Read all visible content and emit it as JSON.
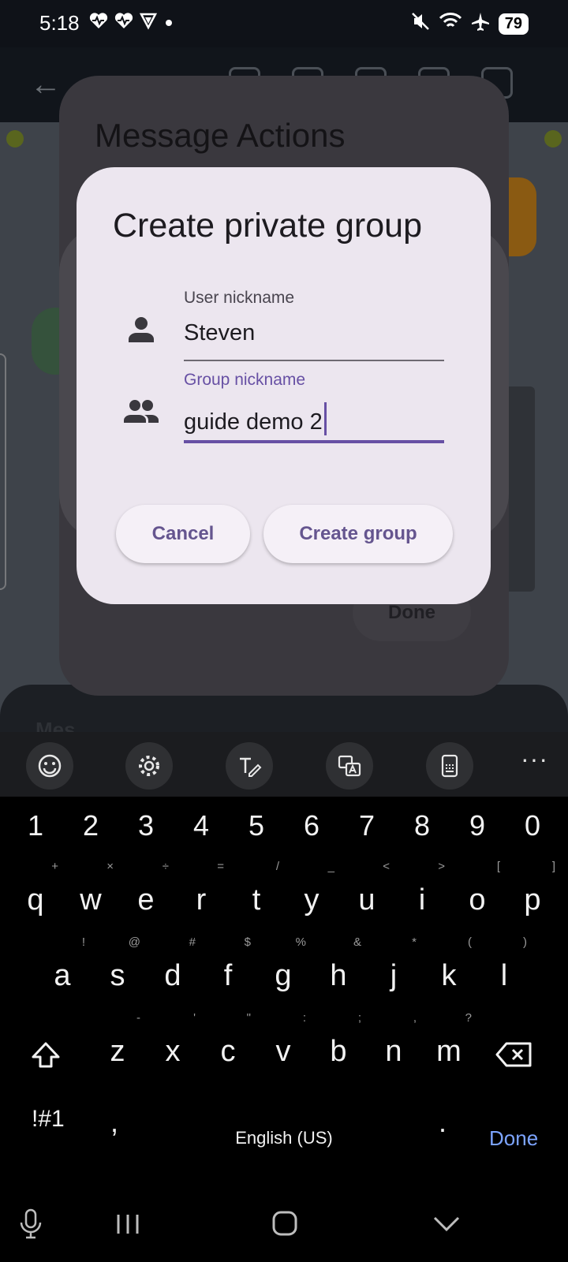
{
  "status_bar": {
    "time": "5:18",
    "battery": "79",
    "left_icons": [
      "heartbeat-icon",
      "heartbeat-icon",
      "vpn-shield-icon",
      "notification-dot-icon"
    ],
    "right_icons": [
      "mute-icon",
      "wifi-icon",
      "airplane-icon"
    ]
  },
  "background_dialog": {
    "title": "Message Actions",
    "done_label": "Done",
    "sheet_text": "Mes"
  },
  "dialog": {
    "title": "Create private group",
    "user_field": {
      "label": "User nickname",
      "value": "Steven"
    },
    "group_field": {
      "label": "Group nickname",
      "value": "guide demo 2"
    },
    "cancel_label": "Cancel",
    "create_label": "Create group",
    "accent_color": "#6750a4"
  },
  "keyboard": {
    "toolbar": [
      "emoji-icon",
      "settings-icon",
      "handwriting-icon",
      "translate-icon",
      "one-handed-icon",
      "more-icon"
    ],
    "more_label": "···",
    "numbers": [
      "1",
      "2",
      "3",
      "4",
      "5",
      "6",
      "7",
      "8",
      "9",
      "0"
    ],
    "row1": [
      "q",
      "w",
      "e",
      "r",
      "t",
      "y",
      "u",
      "i",
      "o",
      "p"
    ],
    "row1_hints": [
      "+",
      "×",
      "÷",
      "=",
      "/",
      "_",
      "<",
      ">",
      "[",
      "]"
    ],
    "row2": [
      "a",
      "s",
      "d",
      "f",
      "g",
      "h",
      "j",
      "k",
      "l"
    ],
    "row2_hints": [
      "!",
      "@",
      "#",
      "$",
      "%",
      "&",
      "*",
      "(",
      ")"
    ],
    "row3": [
      "z",
      "x",
      "c",
      "v",
      "b",
      "n",
      "m"
    ],
    "row3_hints": [
      "-",
      "'",
      "\"",
      ":",
      ";",
      ",",
      "?"
    ],
    "symbols_label": "!#1",
    "comma_label": ",",
    "space_label": "English (US)",
    "period_label": ".",
    "done_label": "Done"
  },
  "navbar": [
    "mic-icon",
    "recent-apps-icon",
    "home-icon",
    "back-icon"
  ]
}
